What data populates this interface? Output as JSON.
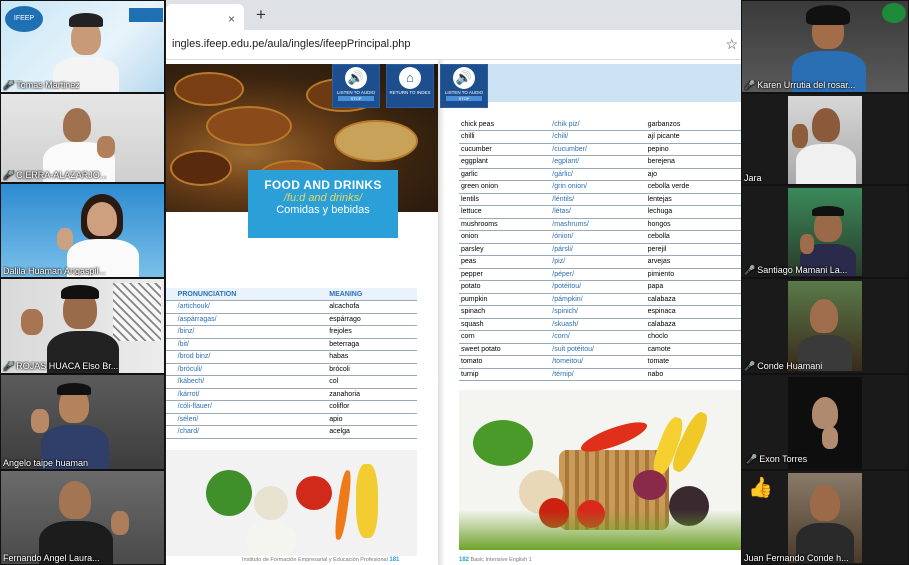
{
  "browser": {
    "url": "ingles.ifeep.edu.pe/aula/ingles/ifeepPrincipal.php",
    "tab_close": "×",
    "new_tab": "+",
    "star": "☆"
  },
  "participants_left": [
    {
      "name": "Tomas Martinez",
      "muted": true
    },
    {
      "name": "CIERRA-ALAZARJO...",
      "muted": true
    },
    {
      "name": "Dalila Huaman Angaspil...",
      "muted": false
    },
    {
      "name": "ROJAS HUACA Elso Br...",
      "muted": true
    },
    {
      "name": "Angelo taipe huaman",
      "muted": false
    },
    {
      "name": "Fernando Angel Laura...",
      "muted": false
    }
  ],
  "participants_right": [
    {
      "name": "Karen Urrutia del rosar...",
      "muted": true
    },
    {
      "name": "Jara",
      "muted": false
    },
    {
      "name": "Santiago Mamani La...",
      "muted": true
    },
    {
      "name": "Conde Huamani",
      "muted": true
    },
    {
      "name": "Exon Torres",
      "muted": true
    },
    {
      "name": "Juan Fernando Conde h...",
      "muted": false
    }
  ],
  "reaction_emoji": "👍",
  "audio_buttons": [
    {
      "label": "LISTEN TO AUDIO",
      "sub": "STOP",
      "icon": "🔊"
    },
    {
      "label": "RETURN TO INDEX",
      "sub": "",
      "icon": "⌂"
    },
    {
      "label": "LISTEN TO AUDIO",
      "sub": "STOP",
      "icon": "🔊"
    }
  ],
  "title": {
    "en": "FOOD AND DRINKS",
    "phon": "/fu:d and drinks/",
    "es": "Comidas y bebidas"
  },
  "left_table": {
    "headers": [
      "",
      "PRONUNCIATION",
      "MEANING"
    ],
    "rows": [
      [
        "",
        "/artichouk/",
        "alcachofa"
      ],
      [
        "",
        "/aspárragas/",
        "espárrago"
      ],
      [
        "",
        "/binz/",
        "frejoles"
      ],
      [
        "",
        "/bit/",
        "beterraga"
      ],
      [
        "",
        "/brod binz/",
        "habas"
      ],
      [
        "",
        "/bróculi/",
        "brócoli"
      ],
      [
        "",
        "/kábech/",
        "col"
      ],
      [
        "",
        "/kárrot/",
        "zanahoria"
      ],
      [
        "",
        "/cóli-flauer/",
        "coliflor"
      ],
      [
        "",
        "/séleri/",
        "apio"
      ],
      [
        "",
        "/chard/",
        "acelga"
      ]
    ]
  },
  "right_table": {
    "rows": [
      [
        "chick peas",
        "/chik piz/",
        "garbanzos"
      ],
      [
        "chilli",
        "/chili/",
        "ají picante"
      ],
      [
        "cucumber",
        "/cucumber/",
        "pepino"
      ],
      [
        "eggplant",
        "/egplant/",
        "berejena"
      ],
      [
        "garlic",
        "/gárlic/",
        "ajo"
      ],
      [
        "green onion",
        "/grin onion/",
        "cebolla verde"
      ],
      [
        "lentils",
        "/léntils/",
        "lentejas"
      ],
      [
        "lettuce",
        "/létas/",
        "lechuga"
      ],
      [
        "mushrooms",
        "/mashrums/",
        "hongos"
      ],
      [
        "onion",
        "/ónion/",
        "cebolla"
      ],
      [
        "parsley",
        "/pársli/",
        "perejil"
      ],
      [
        "peas",
        "/piz/",
        "arvejas"
      ],
      [
        "pepper",
        "/péper/",
        "pimiento"
      ],
      [
        "potato",
        "/potéitou/",
        "papa"
      ],
      [
        "pumpkin",
        "/pámpkin/",
        "calabaza"
      ],
      [
        "spinach",
        "/spinich/",
        "espinaca"
      ],
      [
        "squash",
        "/skuash/",
        "calabaza"
      ],
      [
        "corn",
        "/corn/",
        "choclo"
      ],
      [
        "sweet potato",
        "/suit potéitou/",
        "camote"
      ],
      [
        "tomato",
        "/tomeitou/",
        "tomate"
      ],
      [
        "turnip",
        "/térnip/",
        "nabo"
      ]
    ]
  },
  "footer_left": {
    "text": "Instituto de Formación Empresarial y Educación Profesional",
    "page": "181"
  },
  "footer_right": {
    "page": "182",
    "text": "Basic Intensive English 1"
  },
  "logo_text": "IFEEP"
}
